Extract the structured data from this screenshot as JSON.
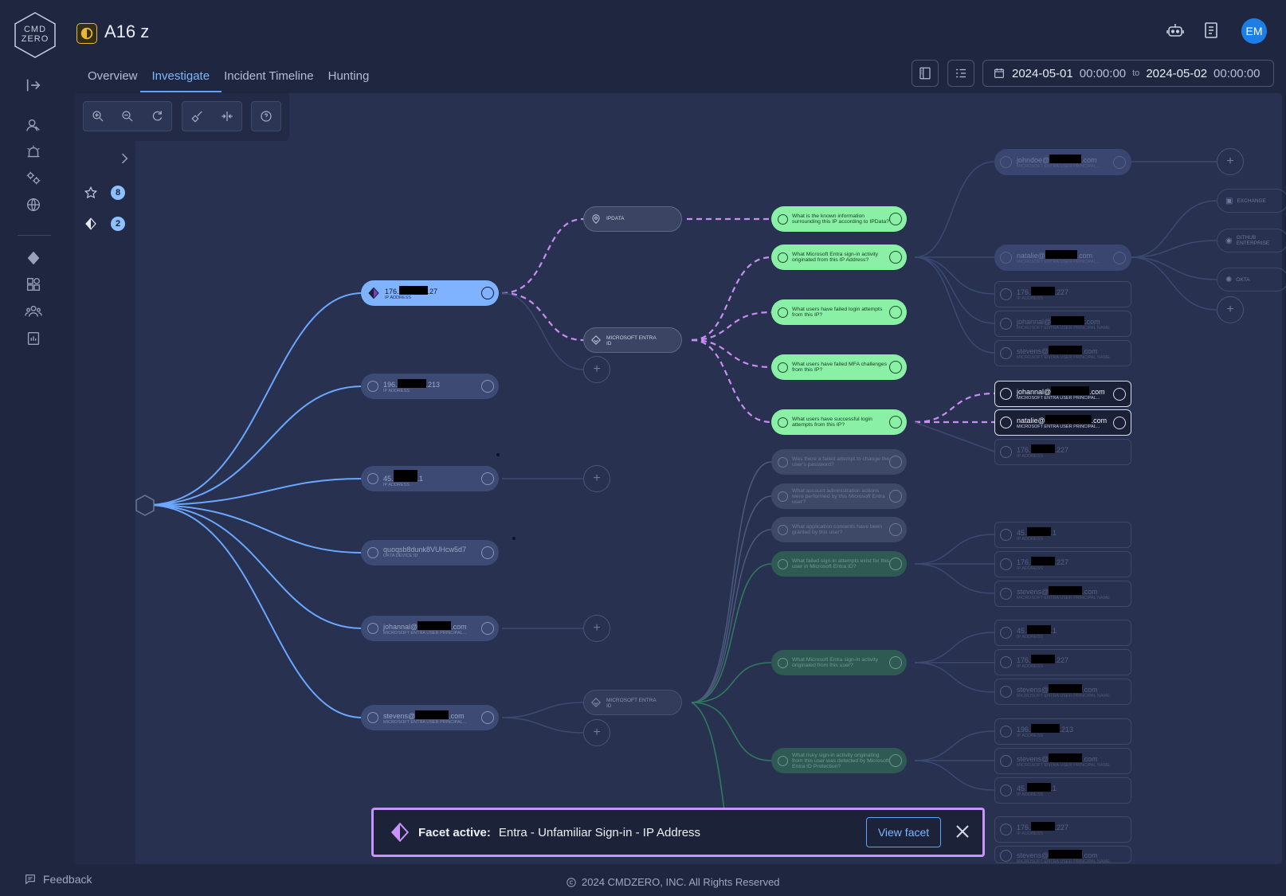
{
  "app": {
    "logo_text": "CMD ZERO",
    "title": "A16 z",
    "avatar": "EM"
  },
  "tabs": [
    {
      "label": "Overview"
    },
    {
      "label": "Investigate"
    },
    {
      "label": "Incident Timeline"
    },
    {
      "label": "Hunting"
    }
  ],
  "daterange": {
    "from_date": "2024-05-01",
    "from_time": "00:00:00",
    "to": "to",
    "to_date": "2024-05-02",
    "to_time": "00:00:00"
  },
  "leftpanel": {
    "starred_count": "8",
    "facet_count": "2"
  },
  "entities": [
    {
      "a": "176.",
      "b": ".27",
      "type": "IP ADDRESS"
    },
    {
      "a": "196.",
      "b": ".213",
      "type": "IP ADDRESS"
    },
    {
      "a": "45.",
      "b": ".1",
      "type": "IP ADDRESS"
    },
    {
      "a": "quoqsb8dunk8VUHcw5d7",
      "b": "",
      "type": "OKTA DEVICE ID"
    },
    {
      "a": "johannal@",
      "b": ".com",
      "type": "MICROSOFT ENTRA USER PRINCIPAL..."
    },
    {
      "a": "stevens@",
      "b": ".com",
      "type": "MICROSOFT ENTRA USER PRINCIPAL..."
    }
  ],
  "sources": {
    "ipdata": "IPDATA",
    "entra1": "MICROSOFT ENTRA ID",
    "entra2": "MICROSOFT ENTRA ID"
  },
  "questions": [
    "What is the known information surrounding this IP according to IPData?",
    "What Microsoft Entra sign-in activity originated from this IP Address?",
    "What users have failed login attempts from this IP?",
    "What users have failed MFA challenges from this IP?",
    "What users have successful login attempts from this IP?",
    "Was there a failed attempt to change the user's password?",
    "What account administration actions were performed by this Microsoft Entra user?",
    "What application consents have been granted by this user?",
    "What failed sign-in attempts exist for this user in Microsoft Entra ID?",
    "What Microsoft Entra sign-in activity originated from this user?",
    "What risky sign-in activity originating from this user was detected by Microsoft Entra ID Protection?"
  ],
  "results": [
    {
      "a": "johndoe@",
      "b": ".com",
      "type": "MICROSOFT ENTRA USER PRINCIPAL..."
    },
    {
      "a": "natalie@",
      "b": ".com",
      "type": "MICROSOFT ENTRA USER PRINCIPAL..."
    },
    {
      "a": "176.",
      "b": ".227",
      "type": "IP ADDRESS"
    },
    {
      "a": "johannal@",
      "b": ".com",
      "type": "MICROSOFT ENTRA USER PRINCIPAL NAME"
    },
    {
      "a": "stevens@",
      "b": ".com",
      "type": "MICROSOFT ENTRA USER PRINCIPAL NAME"
    },
    {
      "a": "johannal@",
      "b": ".com",
      "type": "MICROSOFT ENTRA USER PRINCIPAL..."
    },
    {
      "a": "natalie@",
      "b": ".com",
      "type": "MICROSOFT ENTRA USER PRINCIPAL..."
    },
    {
      "a": "176.",
      "b": ".227",
      "type": "IP ADDRESS"
    },
    {
      "a": "45.",
      "b": ".1",
      "type": "IP ADDRESS"
    },
    {
      "a": "176.",
      "b": ".227",
      "type": "IP ADDRESS"
    },
    {
      "a": "stevens@",
      "b": ".com",
      "type": "MICROSOFT ENTRA USER PRINCIPAL NAME"
    },
    {
      "a": "45.",
      "b": ".1",
      "type": "IP ADDRESS"
    },
    {
      "a": "176.",
      "b": ".227",
      "type": "IP ADDRESS"
    },
    {
      "a": "stevens@",
      "b": ".com",
      "type": "MICROSOFT ENTRA USER PRINCIPAL NAME"
    },
    {
      "a": "196.",
      "b": ".213",
      "type": "IP ADDRESS"
    },
    {
      "a": "stevens@",
      "b": ".com",
      "type": "MICROSOFT ENTRA USER PRINCIPAL NAME"
    },
    {
      "a": "45.",
      "b": ".1",
      "type": "IP ADDRESS"
    },
    {
      "a": "176.",
      "b": ".227",
      "type": "IP ADDRESS"
    },
    {
      "a": "stevens@",
      "b": ".com",
      "type": "MICROSOFT ENTRA USER PRINCIPAL NAME"
    }
  ],
  "apps": {
    "exchange": "EXCHANGE",
    "github": "GITHUB ENTERPRISE",
    "okta": "OKTA"
  },
  "facet": {
    "label": "Facet active:",
    "value": "Entra - Unfamiliar Sign-in - IP Address",
    "button": "View facet"
  },
  "footer": {
    "feedback": "Feedback",
    "copyright": "2024 CMDZERO, INC.  All Rights Reserved"
  },
  "colors": {
    "accent": "#5ea3ff",
    "question": "#8af0a6",
    "facet": "#c993ff",
    "badge": "#e9b730"
  }
}
